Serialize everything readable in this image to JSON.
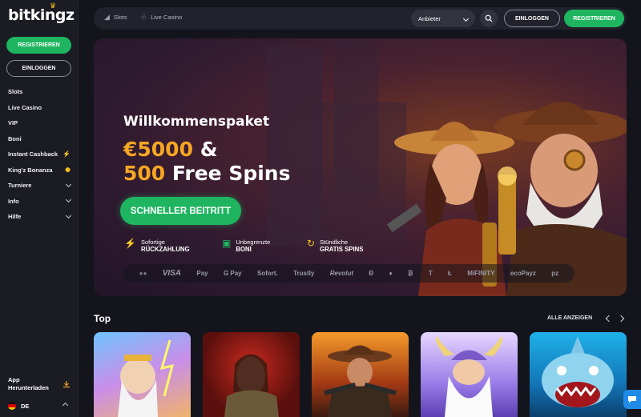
{
  "brand": {
    "name": "bitkingz"
  },
  "sidebar": {
    "register_label": "REGISTRIEREN",
    "login_label": "EINLOGGEN",
    "items": [
      {
        "label": "Slots",
        "icon": ""
      },
      {
        "label": "Live Casino",
        "icon": ""
      },
      {
        "label": "VIP",
        "icon": ""
      },
      {
        "label": "Boni",
        "icon": ""
      },
      {
        "label": "Instant Cashback",
        "icon": "lightning-icon"
      },
      {
        "label": "King'z Bonanza",
        "icon": "sun-icon"
      },
      {
        "label": "Turniere",
        "icon": "chevron-down-icon"
      },
      {
        "label": "Info",
        "icon": "chevron-down-icon"
      },
      {
        "label": "Hilfe",
        "icon": "chevron-down-icon"
      }
    ],
    "app_download": "App Herunterladen",
    "language": "DE"
  },
  "topbar": {
    "slots_label": "Slots",
    "live_casino_label": "Live Casino",
    "provider_select": "Anbieter",
    "login_label": "EINLOGGEN",
    "register_label": "REGISTRIEREN"
  },
  "hero": {
    "title": "Willkommenspaket",
    "line1_amount": "€5000",
    "line1_rest": " &",
    "line2_amount": "500",
    "line2_rest": " Free Spins",
    "cta": "SCHNELLER BEITRITT",
    "features": [
      {
        "line1": "Sofortige",
        "line2": "RÜCKZAHLUNG",
        "icon": "lightning-icon"
      },
      {
        "line1": "Unbegrenzte",
        "line2": "BONI",
        "icon": "gift-icon"
      },
      {
        "line1": "Stündliche",
        "line2": "GRATIS SPINS",
        "icon": "refresh-icon"
      }
    ],
    "payments": [
      "VISA",
      " Pay",
      "G Pay",
      "Sofort.",
      "Trustly",
      "Revolut",
      "Ð",
      "♦",
      "₿",
      "T",
      "Ł",
      "MiFINITY",
      "ecoPayz",
      "pz"
    ]
  },
  "top_section": {
    "title": "Top",
    "show_all": "ALLE ANZEIGEN"
  },
  "colors": {
    "accent_green": "#1fb560",
    "gold": "#f6a623",
    "sidebar_bg": "#1b1b24",
    "page_bg": "#14141c"
  }
}
